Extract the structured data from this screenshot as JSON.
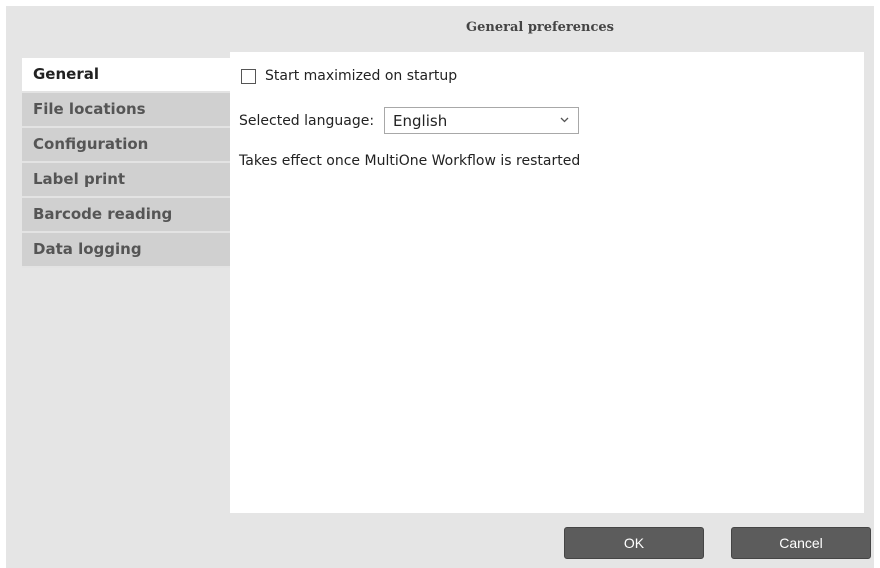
{
  "dialog": {
    "title": "General preferences"
  },
  "sidebar": {
    "items": [
      {
        "label": "General",
        "active": true
      },
      {
        "label": "File locations",
        "active": false
      },
      {
        "label": "Configuration",
        "active": false
      },
      {
        "label": "Label print",
        "active": false
      },
      {
        "label": "Barcode reading",
        "active": false
      },
      {
        "label": "Data logging",
        "active": false
      }
    ]
  },
  "general": {
    "start_maximized_label": "Start maximized on startup",
    "start_maximized_checked": false,
    "language_label": "Selected language:",
    "language_value": "English",
    "restart_note": "Takes effect once MultiOne Workflow is restarted"
  },
  "footer": {
    "ok_label": "OK",
    "cancel_label": "Cancel"
  },
  "icons": {
    "dropdown": "chevron-down-icon"
  }
}
